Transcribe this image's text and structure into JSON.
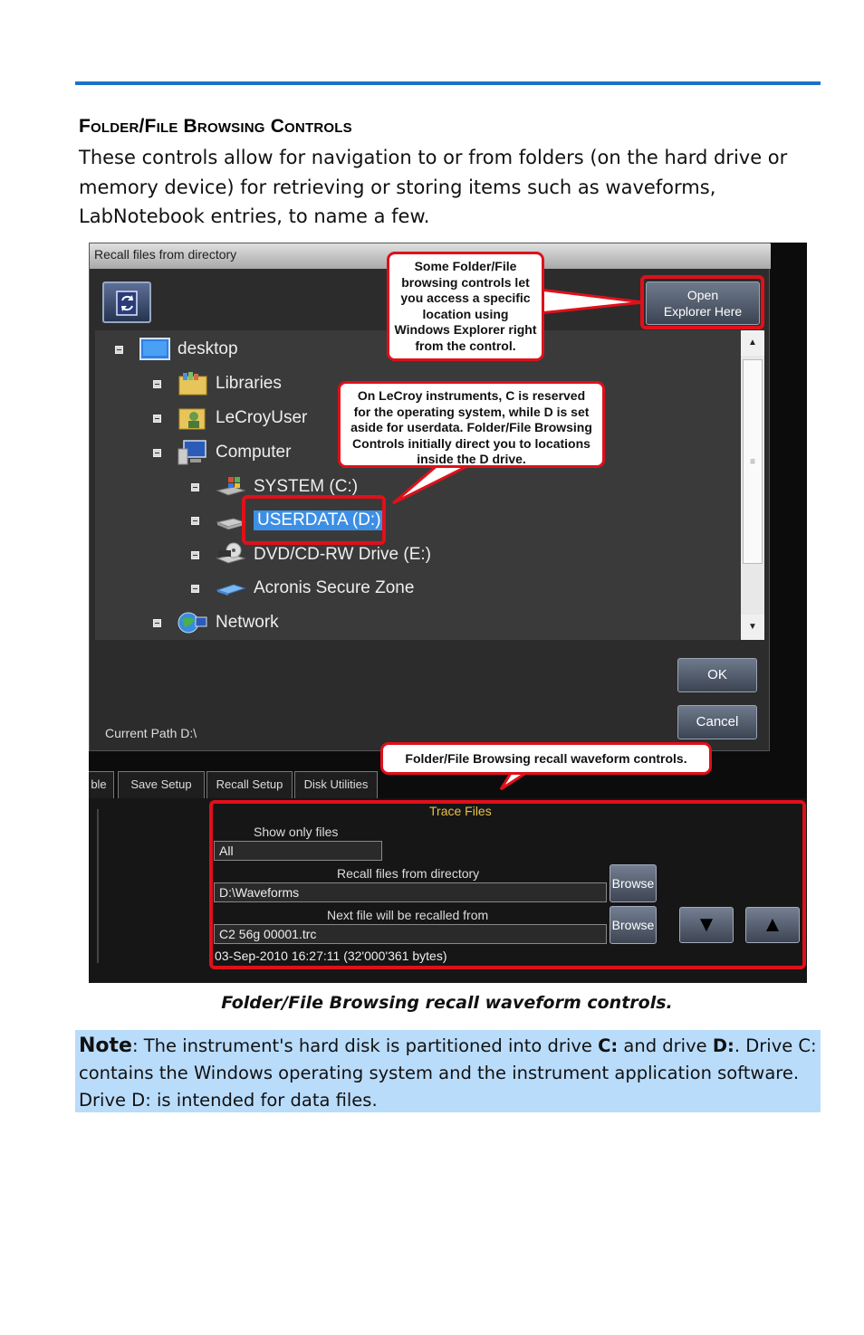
{
  "heading": "Folder/File Browsing Controls",
  "intro": "These controls allow for navigation to or from folders (on the hard drive or memory device) for retrieving or storing items such as waveforms, LabNotebook entries, to name a few.",
  "dialog": {
    "title": "Recall files from directory",
    "open_explorer": [
      "Open",
      "Explorer Here"
    ],
    "tree": [
      {
        "label": "desktop",
        "icon": "desktop-icon",
        "level": 0
      },
      {
        "label": "Libraries",
        "icon": "libraries-icon",
        "level": 1
      },
      {
        "label": "LeCroyUser",
        "icon": "user-folder-icon",
        "level": 1
      },
      {
        "label": "Computer",
        "icon": "computer-icon",
        "level": 1
      },
      {
        "label": "SYSTEM (C:)",
        "icon": "system-drive-icon",
        "level": 2
      },
      {
        "label": "USERDATA (D:)",
        "icon": "drive-icon",
        "level": 2,
        "selected": true
      },
      {
        "label": "DVD/CD-RW Drive (E:)",
        "icon": "dvd-drive-icon",
        "level": 2
      },
      {
        "label": "Acronis Secure Zone",
        "icon": "secure-zone-icon",
        "level": 2
      },
      {
        "label": "Network",
        "icon": "network-icon",
        "level": 1
      }
    ],
    "ok": "OK",
    "cancel": "Cancel",
    "current_path": "Current Path  D:\\"
  },
  "tabs": [
    "ble",
    "Save Setup",
    "Recall Setup",
    "Disk Utilities"
  ],
  "trace_panel": {
    "title": "Trace Files",
    "show_only_label": "Show only files",
    "show_only_value": "All",
    "recall_dir_label": "Recall files from directory",
    "recall_dir_value": "D:\\Waveforms",
    "next_file_label": "Next file will be recalled from",
    "next_file_value": "C2 56g 00001.trc",
    "browse": "Browse",
    "timestamp": "03-Sep-2010 16:27:11 (32'000'361 bytes)"
  },
  "callouts": {
    "explorer": [
      "Some Folder/File",
      "browsing controls let",
      "you access a specific",
      "location using",
      "Windows Explorer right",
      "from the control."
    ],
    "drives": [
      "On LeCroy instruments, C is reserved",
      "for the operating system, while D is set",
      "aside for userdata. Folder/File Browsing",
      "Controls initially direct you to locations",
      "inside the D drive."
    ],
    "recall": "Folder/File Browsing recall waveform controls."
  },
  "caption": "Folder/File Browsing recall waveform controls.",
  "note": {
    "label": "Note",
    "t1": ": The instrument's hard disk is partitioned into drive ",
    "c": "C:",
    "t2": " and drive ",
    "d": "D:",
    "t3": ". Drive C: contains the Windows operating system and the instrument application software. Drive D: is intended for data files."
  },
  "colors": {
    "accent": "#1a73c5",
    "highlight": "#e0101a",
    "note_bg": "#b9dcfb",
    "selection": "#3d8fe5"
  }
}
